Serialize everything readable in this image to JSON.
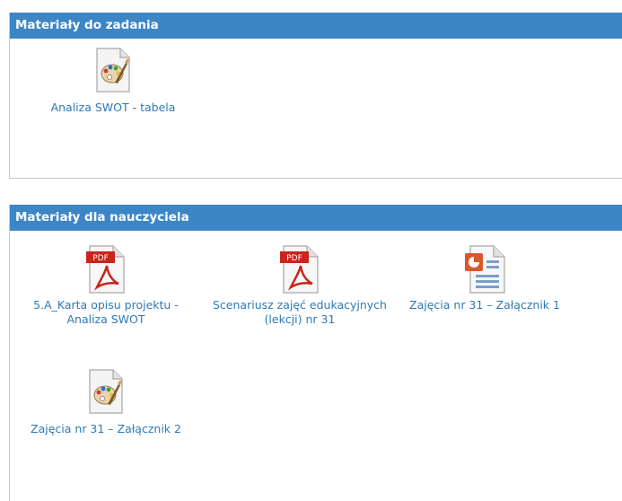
{
  "sections": [
    {
      "title": "Materiały do zadania",
      "files": [
        {
          "name": "Analiza SWOT - tabela",
          "icon": "paint-file-icon"
        }
      ]
    },
    {
      "title": "Materiały dla nauczyciela",
      "files": [
        {
          "name": "5.A_Karta opisu projektu - Analiza SWOT",
          "icon": "pdf-file-icon",
          "icon_text": "PDF"
        },
        {
          "name": "Scenariusz zajęć edukacyjnych (lekcji) nr 31",
          "icon": "pdf-file-icon",
          "icon_text": "PDF"
        },
        {
          "name": "Zajęcia nr 31 – Załącznik 1",
          "icon": "presentation-file-icon"
        },
        {
          "name": "Zajęcia nr 31 – Załącznik 2",
          "icon": "paint-file-icon"
        }
      ]
    }
  ],
  "colors": {
    "header_bg": "#3d86c6",
    "header_text": "#ffffff",
    "link": "#2c7ab8",
    "pdf_red": "#c8261c"
  }
}
